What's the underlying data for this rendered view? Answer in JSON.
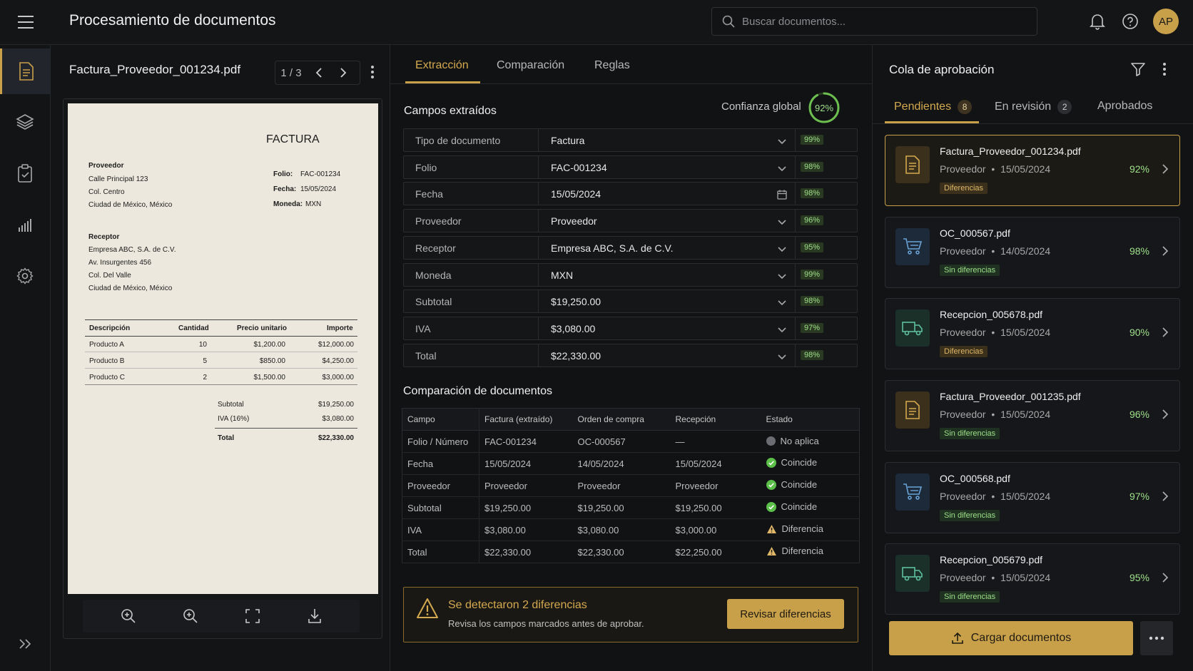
{
  "app": {
    "title": "Procesamiento de documentos",
    "avatar": "AP"
  },
  "search": {
    "placeholder": "Buscar documentos..."
  },
  "preview": {
    "filename": "Factura_Proveedor_001234.pdf",
    "page_indicator": "1 / 3",
    "invoice": {
      "heading": "FACTURA",
      "supplier_label": "Proveedor",
      "supplier_lines": [
        "Calle Principal 123",
        "Col. Centro",
        "Ciudad de México, México"
      ],
      "meta": [
        {
          "label": "Folio:",
          "value": "FAC-001234"
        },
        {
          "label": "Fecha:",
          "value": "15/05/2024"
        },
        {
          "label": "Moneda:",
          "value": "MXN"
        }
      ],
      "receiver_label": "Receptor",
      "receiver_lines": [
        "Empresa ABC, S.A. de C.V.",
        "Av. Insurgentes 456",
        "Col. Del Valle",
        "Ciudad de México, México"
      ],
      "table_headers": [
        "Descripción",
        "Cantidad",
        "Precio unitario",
        "Importe"
      ],
      "items": [
        {
          "desc": "Producto A",
          "qty": "10",
          "price": "$1,200.00",
          "amount": "$12,000.00"
        },
        {
          "desc": "Producto B",
          "qty": "5",
          "price": "$850.00",
          "amount": "$4,250.00"
        },
        {
          "desc": "Producto C",
          "qty": "2",
          "price": "$1,500.00",
          "amount": "$3,000.00"
        }
      ],
      "subtotal_label": "Subtotal",
      "subtotal": "$19,250.00",
      "iva_label": "IVA (16%)",
      "iva": "$3,080.00",
      "total_label": "Total",
      "total": "$22,330.00"
    }
  },
  "tabs": [
    "Extracción",
    "Comparación",
    "Reglas"
  ],
  "extraction": {
    "title": "Campos extraídos",
    "confidence_label": "Confianza global",
    "confidence": "92%",
    "confidence_value": 0.92,
    "fields": [
      {
        "label": "Tipo de documento",
        "value": "Factura",
        "pct": "99%",
        "control": "chevron"
      },
      {
        "label": "Folio",
        "value": "FAC-001234",
        "pct": "98%",
        "control": "chevron"
      },
      {
        "label": "Fecha",
        "value": "15/05/2024",
        "pct": "98%",
        "control": "calendar"
      },
      {
        "label": "Proveedor",
        "value": "Proveedor",
        "pct": "96%",
        "control": "chevron"
      },
      {
        "label": "Receptor",
        "value": "Empresa ABC, S.A. de C.V.",
        "pct": "95%",
        "control": "chevron"
      },
      {
        "label": "Moneda",
        "value": "MXN",
        "pct": "99%",
        "control": "chevron"
      },
      {
        "label": "Subtotal",
        "value": "$19,250.00",
        "pct": "98%",
        "control": "chevron"
      },
      {
        "label": "IVA",
        "value": "$3,080.00",
        "pct": "97%",
        "control": "chevron"
      },
      {
        "label": "Total",
        "value": "$22,330.00",
        "pct": "98%",
        "control": "chevron"
      }
    ]
  },
  "comparison": {
    "title": "Comparación de documentos",
    "headers": [
      "Campo",
      "Factura (extraído)",
      "Orden de compra",
      "Recepción",
      "Estado"
    ],
    "rows": [
      {
        "field": "Folio / Número",
        "invoice": "FAC-001234",
        "po": "OC-000567",
        "receipt": "—",
        "status": "No aplica",
        "kind": "na"
      },
      {
        "field": "Fecha",
        "invoice": "15/05/2024",
        "po": "14/05/2024",
        "receipt": "15/05/2024",
        "status": "Coincide",
        "kind": "ok"
      },
      {
        "field": "Proveedor",
        "invoice": "Proveedor",
        "po": "Proveedor",
        "receipt": "Proveedor",
        "status": "Coincide",
        "kind": "ok"
      },
      {
        "field": "Subtotal",
        "invoice": "$19,250.00",
        "po": "$19,250.00",
        "receipt": "$19,250.00",
        "status": "Coincide",
        "kind": "ok"
      },
      {
        "field": "IVA",
        "invoice": "$3,080.00",
        "po": "$3,080.00",
        "receipt": "$3,000.00",
        "status": "Diferencia",
        "kind": "warn"
      },
      {
        "field": "Total",
        "invoice": "$22,330.00",
        "po": "$22,330.00",
        "receipt": "$22,250.00",
        "status": "Diferencia",
        "kind": "warn"
      }
    ]
  },
  "alert": {
    "title": "Se detectaron 2 diferencias",
    "subtitle": "Revisa los campos marcados antes de aprobar.",
    "button": "Revisar diferencias"
  },
  "queue": {
    "title": "Cola de aprobación",
    "tabs": [
      {
        "label": "Pendientes",
        "count": "8"
      },
      {
        "label": "En revisión",
        "count": "2"
      },
      {
        "label": "Aprobados",
        "count": ""
      }
    ],
    "items": [
      {
        "name": "Factura_Proveedor_001234.pdf",
        "vendor": "Proveedor",
        "date": "15/05/2024",
        "tag": "Diferencias",
        "tag_kind": "diff",
        "pct": "92%",
        "icon": "invoice-icon"
      },
      {
        "name": "OC_000567.pdf",
        "vendor": "Proveedor",
        "date": "14/05/2024",
        "tag": "Sin diferencias",
        "tag_kind": "ok",
        "pct": "98%",
        "icon": "cart-icon"
      },
      {
        "name": "Recepcion_005678.pdf",
        "vendor": "Proveedor",
        "date": "15/05/2024",
        "tag": "Diferencias",
        "tag_kind": "diff",
        "pct": "90%",
        "icon": "truck-icon"
      },
      {
        "name": "Factura_Proveedor_001235.pdf",
        "vendor": "Proveedor",
        "date": "15/05/2024",
        "tag": "Sin diferencias",
        "tag_kind": "ok",
        "pct": "96%",
        "icon": "invoice-icon"
      },
      {
        "name": "OC_000568.pdf",
        "vendor": "Proveedor",
        "date": "15/05/2024",
        "tag": "Sin diferencias",
        "tag_kind": "ok",
        "pct": "97%",
        "icon": "cart-icon"
      },
      {
        "name": "Recepcion_005679.pdf",
        "vendor": "Proveedor",
        "date": "15/05/2024",
        "tag": "Sin diferencias",
        "tag_kind": "ok",
        "pct": "95%",
        "icon": "truck-icon"
      }
    ],
    "upload_button": "Cargar documentos"
  },
  "colors": {
    "accent": "#c9a04a",
    "success": "#9ee08a",
    "warning": "#e0b867",
    "neutral": "#6b6d72"
  }
}
